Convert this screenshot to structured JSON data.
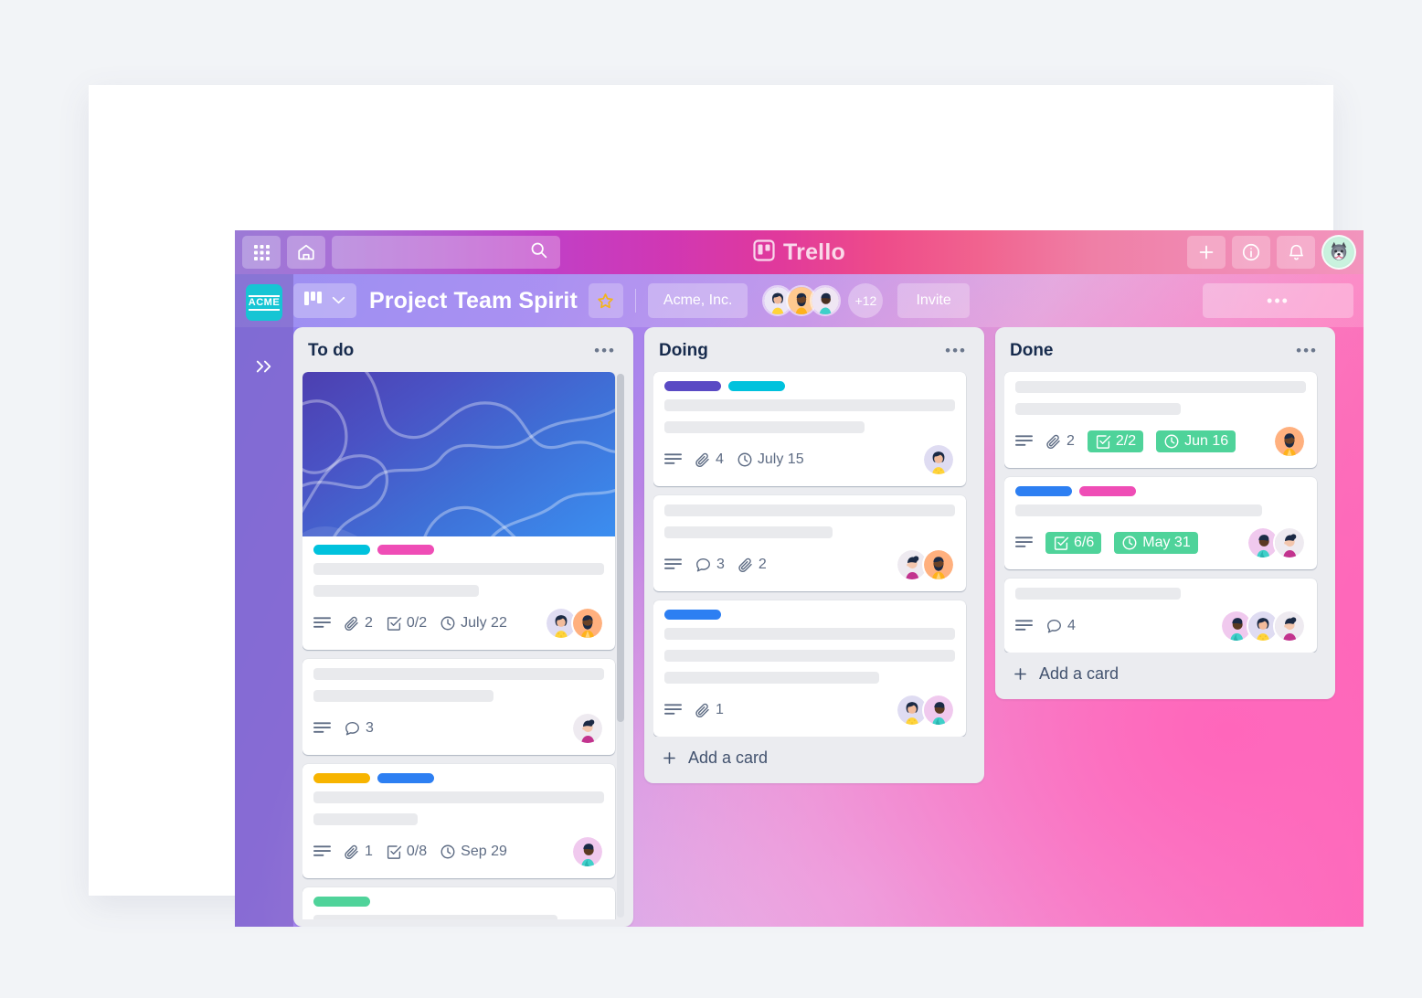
{
  "topbar": {
    "apps_icon": "grid-apps-icon",
    "home_icon": "home-icon",
    "search_icon": "search-icon",
    "search_placeholder": "",
    "brand_logo_icon": "trello-logo-icon",
    "brand_name": "Trello",
    "create_icon": "plus-icon",
    "info_icon": "info-icon",
    "notifications_icon": "bell-icon",
    "account_avatar": "husky-avatar"
  },
  "sidebar": {
    "logo_text": "ACME",
    "expand_icon": "chevron-double-right-icon"
  },
  "boardbar": {
    "view_icon": "board-view-icon",
    "view_chevron_icon": "chevron-down-icon",
    "title": "Project Team Spirit",
    "star_icon": "star-icon",
    "workspace": "Acme, Inc.",
    "member_overflow": "+12",
    "invite_label": "Invite",
    "menu_label": "•••"
  },
  "board": {
    "lists": [
      {
        "title": "To do",
        "menu_icon": "ellipsis-icon",
        "has_scrollbar": true,
        "add_card_label": null,
        "cards": [
          {
            "cover": "blue-abstract-cover",
            "labels": [
              "#00c2dd",
              "#ef4db6"
            ],
            "skeletons": [
              100,
              57
            ],
            "badges": [
              {
                "type": "description",
                "icon": "description-icon",
                "text": ""
              },
              {
                "type": "attachment",
                "icon": "attachment-icon",
                "text": "2"
              },
              {
                "type": "checklist",
                "icon": "checklist-icon",
                "text": "0/2"
              },
              {
                "type": "due",
                "icon": "clock-icon",
                "text": "July 22"
              }
            ],
            "avatars": [
              "yellow-shirt-bob",
              "orange-beard"
            ]
          },
          {
            "cover": null,
            "labels": [],
            "skeletons": [
              100,
              62
            ],
            "badges": [
              {
                "type": "description",
                "icon": "description-icon",
                "text": ""
              },
              {
                "type": "comment",
                "icon": "comment-icon",
                "text": "3"
              }
            ],
            "avatars": [
              "purple-bun"
            ]
          },
          {
            "cover": null,
            "labels": [
              "#f7b400",
              "#2d7ff2"
            ],
            "skeletons": [
              100,
              36
            ],
            "badges": [
              {
                "type": "description",
                "icon": "description-icon",
                "text": ""
              },
              {
                "type": "attachment",
                "icon": "attachment-icon",
                "text": "1"
              },
              {
                "type": "checklist",
                "icon": "checklist-icon",
                "text": "0/8"
              },
              {
                "type": "due",
                "icon": "clock-icon",
                "text": "Sep 29"
              }
            ],
            "avatars": [
              "teal-shirt"
            ]
          },
          {
            "cover": null,
            "labels": [
              "#4fd39a"
            ],
            "skeletons": [
              84
            ],
            "badges": [],
            "avatars": []
          }
        ]
      },
      {
        "title": "Doing",
        "menu_icon": "ellipsis-icon",
        "has_scrollbar": false,
        "add_card_label": "Add a card",
        "cards": [
          {
            "cover": null,
            "labels": [
              "#5a4ac4",
              "#00c2dd"
            ],
            "skeletons": [
              100,
              69
            ],
            "badges": [
              {
                "type": "description",
                "icon": "description-icon",
                "text": ""
              },
              {
                "type": "attachment",
                "icon": "attachment-icon",
                "text": "4"
              },
              {
                "type": "due",
                "icon": "clock-icon",
                "text": "July 15"
              }
            ],
            "avatars": [
              "yellow-shirt-bob"
            ]
          },
          {
            "cover": null,
            "labels": [],
            "skeletons": [
              100,
              58
            ],
            "badges": [
              {
                "type": "description",
                "icon": "description-icon",
                "text": ""
              },
              {
                "type": "comment",
                "icon": "comment-icon",
                "text": "3"
              },
              {
                "type": "attachment",
                "icon": "attachment-icon",
                "text": "2"
              }
            ],
            "avatars": [
              "purple-bun",
              "orange-beard"
            ]
          },
          {
            "cover": null,
            "labels": [
              "#2d7ff2"
            ],
            "skeletons": [
              100,
              100,
              74
            ],
            "badges": [
              {
                "type": "description",
                "icon": "description-icon",
                "text": ""
              },
              {
                "type": "attachment",
                "icon": "attachment-icon",
                "text": "1"
              }
            ],
            "avatars": [
              "yellow-shirt-bob",
              "teal-shirt"
            ]
          }
        ]
      },
      {
        "title": "Done",
        "menu_icon": "ellipsis-icon",
        "has_scrollbar": false,
        "add_card_label": "Add a card",
        "cards": [
          {
            "cover": null,
            "labels": [],
            "skeletons": [
              100,
              57
            ],
            "badges": [
              {
                "type": "description",
                "icon": "description-icon",
                "text": ""
              },
              {
                "type": "attachment",
                "icon": "attachment-icon",
                "text": "2"
              },
              {
                "type": "checklist-done",
                "icon": "checklist-icon",
                "text": "2/2"
              },
              {
                "type": "due-done",
                "icon": "clock-icon",
                "text": "Jun 16"
              }
            ],
            "avatars": [
              "orange-beard"
            ]
          },
          {
            "cover": null,
            "labels": [
              "#2d7ff2",
              "#ef4db6"
            ],
            "skeletons": [
              85
            ],
            "badges": [
              {
                "type": "description",
                "icon": "description-icon",
                "text": ""
              },
              {
                "type": "checklist-done",
                "icon": "checklist-icon",
                "text": "6/6"
              },
              {
                "type": "due-done",
                "icon": "clock-icon",
                "text": "May 31"
              }
            ],
            "avatars": [
              "teal-shirt",
              "purple-bun"
            ]
          },
          {
            "cover": null,
            "labels": [],
            "skeletons": [
              57
            ],
            "badges": [
              {
                "type": "description",
                "icon": "description-icon",
                "text": ""
              },
              {
                "type": "comment",
                "icon": "comment-icon",
                "text": "4"
              }
            ],
            "avatars": [
              "teal-shirt",
              "yellow-shirt-bob",
              "purple-bun"
            ]
          }
        ]
      }
    ]
  },
  "colors": {
    "label_cyan": "#00c2dd",
    "label_pink": "#ef4db6",
    "label_yellow": "#f7b400",
    "label_blue": "#2d7ff2",
    "label_green": "#4fd39a",
    "label_purple": "#5a4ac4",
    "done_badge": "#4fd39a",
    "list_bg": "#ebecf0",
    "brand_teal": "#16c5d4"
  }
}
